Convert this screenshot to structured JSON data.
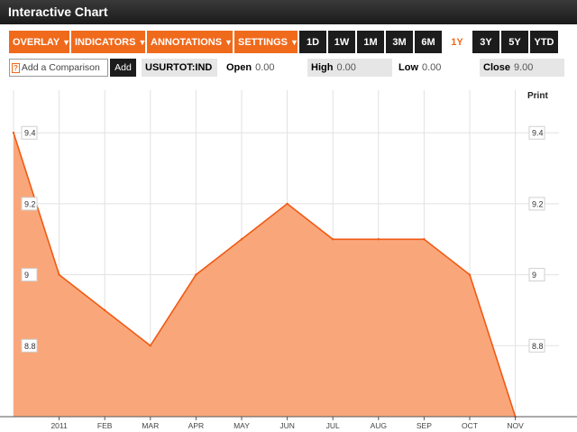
{
  "window": {
    "title": "Interactive Chart"
  },
  "menus": [
    {
      "label": "OVERLAY"
    },
    {
      "label": "INDICATORS"
    },
    {
      "label": "ANNOTATIONS"
    },
    {
      "label": "SETTINGS"
    }
  ],
  "ranges": [
    {
      "label": "1D",
      "active": false
    },
    {
      "label": "1W",
      "active": false
    },
    {
      "label": "1M",
      "active": false
    },
    {
      "label": "3M",
      "active": false
    },
    {
      "label": "6M",
      "active": false
    },
    {
      "label": "1Y",
      "active": true
    },
    {
      "label": "3Y",
      "active": false
    },
    {
      "label": "5Y",
      "active": false
    },
    {
      "label": "YTD",
      "active": false
    }
  ],
  "quote": {
    "compare_placeholder": "Add a Comparison",
    "help_glyph": "?",
    "add_label": "Add",
    "ticker": "USURTOT:IND",
    "open_label": "Open",
    "open_value": "0.00",
    "high_label": "High",
    "high_value": "0.00",
    "low_label": "Low",
    "low_value": "0.00",
    "close_label": "Close",
    "close_value": "9.00"
  },
  "print_label": "Print",
  "colors": {
    "accent": "#f06a1c",
    "area_fill": "#f9a77a",
    "line": "#f05a14",
    "grid": "#e2e2e2"
  },
  "chart_data": {
    "type": "area",
    "series": [
      {
        "values": [
          9.4,
          9.0,
          8.9,
          8.8,
          9.0,
          9.1,
          9.2,
          9.1,
          9.1,
          9.1,
          9.0,
          8.6
        ]
      }
    ],
    "x_tick_labels": [
      "2011",
      "FEB",
      "MAR",
      "APR",
      "MAY",
      "JUN",
      "JUL",
      "AUG",
      "SEP",
      "OCT",
      "NOV"
    ],
    "y_ticks": [
      8.8,
      9.0,
      9.2,
      9.4
    ],
    "y_tick_labels": [
      "8.8",
      "9",
      "9.2",
      "9.4"
    ],
    "ylim": [
      8.6,
      9.52
    ],
    "grid": true,
    "title": "",
    "xlabel": "",
    "ylabel": ""
  }
}
